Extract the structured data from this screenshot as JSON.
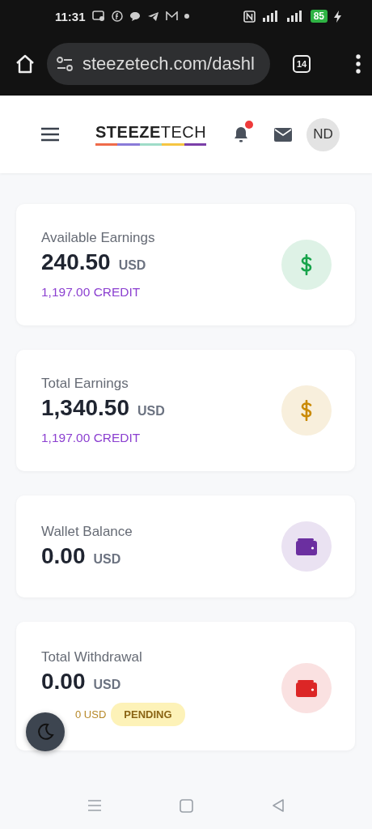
{
  "status_bar": {
    "time": "11:31",
    "battery": "85"
  },
  "browser": {
    "url": "steezetech.com/dashl",
    "tab_count": "14"
  },
  "header": {
    "logo": "**STEEZE**TECH",
    "notifications_unread": true,
    "avatar": "ND"
  },
  "cards": [
    {
      "label": "Available Earnings",
      "amount": "240.50",
      "currency": "USD",
      "sub": "1,197.00 CREDIT",
      "kind": "dollar",
      "color": "#16a34a"
    },
    {
      "label": "Total Earnings",
      "amount": "1,340.50",
      "currency": "USD",
      "sub": "1,197.00 CREDIT",
      "kind": "dollar",
      "color": "#ca8a04"
    },
    {
      "label": "Wallet Balance",
      "amount": "0.00",
      "currency": "USD",
      "kind": "wallet",
      "color": "#6b2fa0"
    },
    {
      "label": "Total Withdrawal",
      "amount": "0.00",
      "currency": "USD",
      "pending_amount": "0 USD",
      "badge": "PENDING",
      "kind": "wallet",
      "color": "#dc2626"
    }
  ]
}
